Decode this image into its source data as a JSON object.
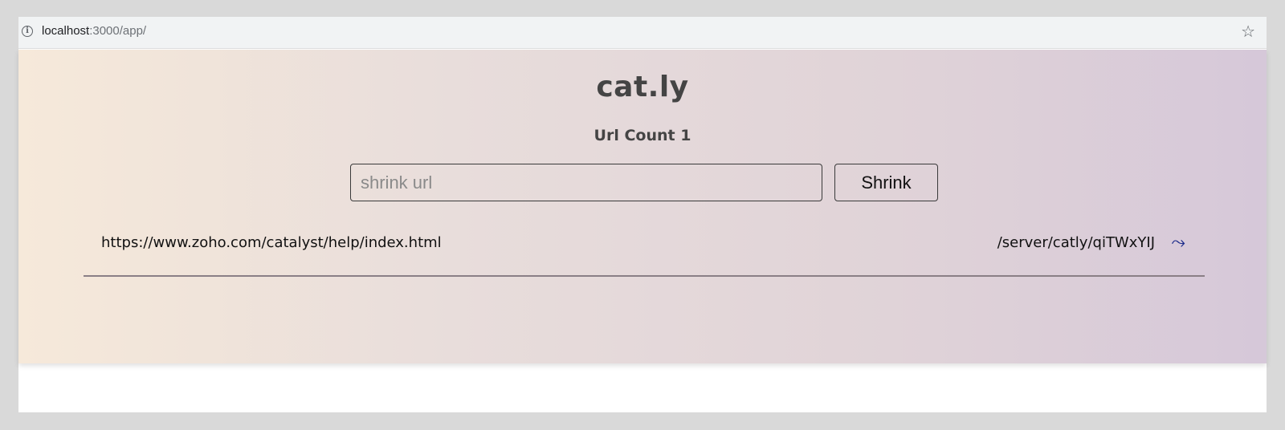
{
  "browser": {
    "url_host": "localhost",
    "url_path": ":3000/app/",
    "info_icon": "info-icon",
    "star_icon": "star-icon"
  },
  "app": {
    "title": "cat.ly",
    "count_text": "Url Count 1"
  },
  "form": {
    "placeholder": "shrink url",
    "button_label": "Shrink"
  },
  "urls": [
    {
      "long_url": "https://www.zoho.com/catalyst/help/index.html",
      "short_url": "/server/catly/qiTWxYIJ",
      "go_icon": "wavy-arrow-right-icon"
    }
  ],
  "colors": {
    "gradient_start": "#f6e9da",
    "gradient_end": "#d6c8d9",
    "link_arrow": "#1a2a8a"
  }
}
